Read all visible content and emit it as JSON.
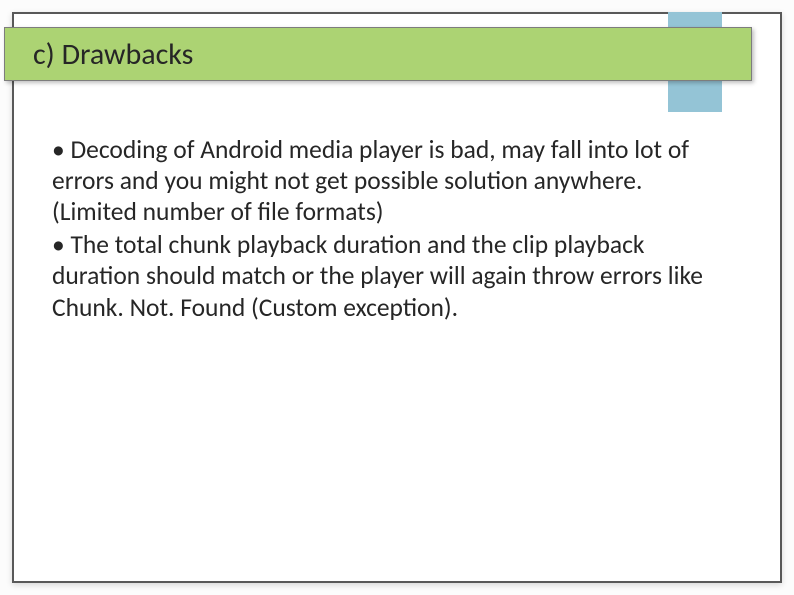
{
  "slide": {
    "title": "c) Drawbacks",
    "bullets": [
      "• Decoding of Android media player is bad, may fall into lot of errors and you might not get possible solution anywhere. (Limited number of file formats)",
      "• The total chunk playback duration and the clip playback duration should match or the player will again throw errors like Chunk. Not. Found (Custom exception)."
    ]
  }
}
